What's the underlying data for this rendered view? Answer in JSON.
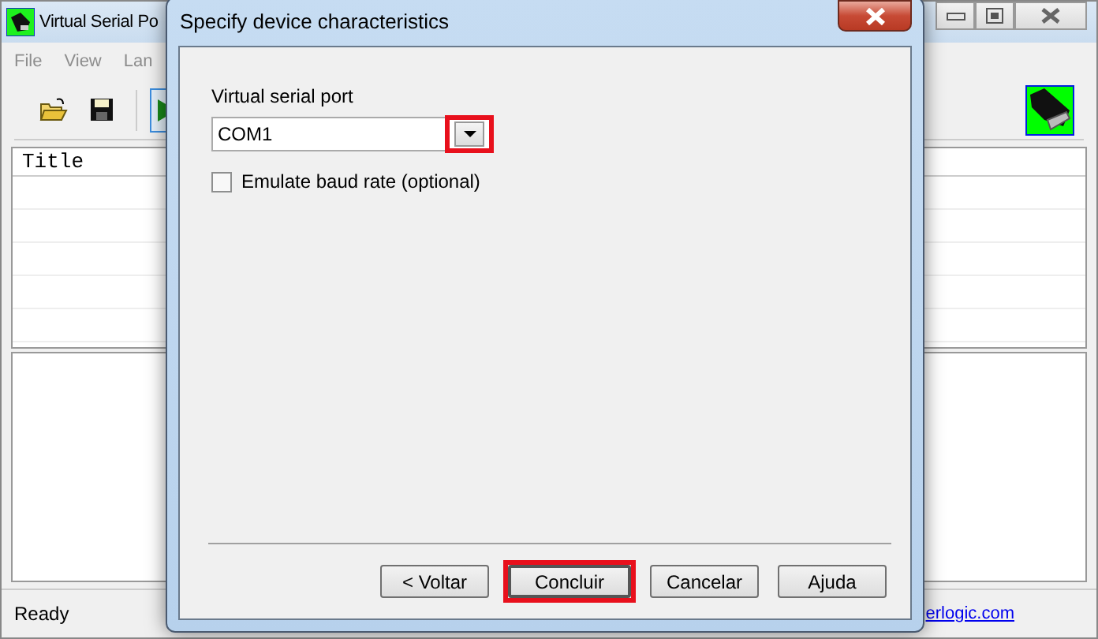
{
  "main_window": {
    "title": "Virtual Serial Po",
    "menu": [
      {
        "label": "File",
        "disabled": true
      },
      {
        "label": "View",
        "disabled": true
      },
      {
        "label": "Lan",
        "disabled": true
      }
    ],
    "list": {
      "columns": [
        "Title"
      ]
    },
    "status_bar": {
      "text": "Ready",
      "link": "erlogic.com"
    }
  },
  "dialog": {
    "title": "Specify device characteristics",
    "port_field": {
      "label": "Virtual serial port",
      "value": "COM1",
      "dropdown_highlighted": true
    },
    "checkbox": {
      "label": "Emulate baud rate (optional)",
      "checked": false
    },
    "buttons": [
      {
        "label": "< Voltar",
        "highlighted": false
      },
      {
        "label": "Concluir",
        "highlighted": true
      },
      {
        "label": "Cancelar",
        "highlighted": false
      },
      {
        "label": "Ajuda",
        "highlighted": false
      }
    ]
  }
}
